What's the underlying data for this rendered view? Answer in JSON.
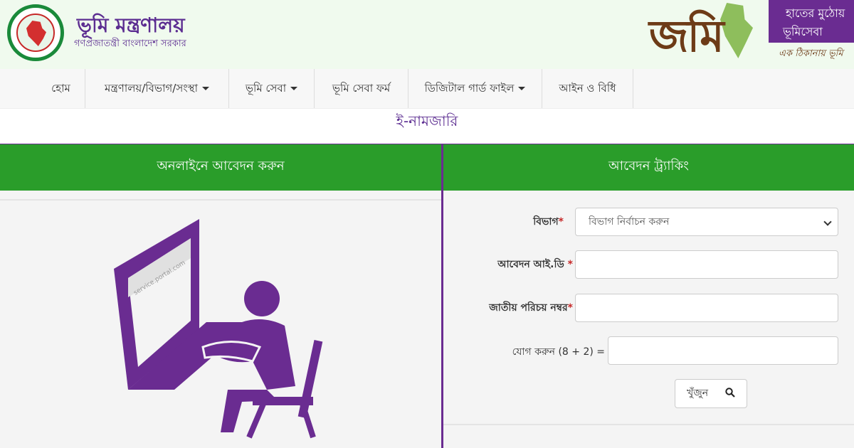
{
  "header": {
    "title": "ভূমি মন্ত্রণালয়",
    "subtitle": "গণপ্রজাতন্ত্রী বাংলাদেশ সরকার",
    "seal": {
      "text_top": "গণপ্রজাতন্ত্রী বাংলাদেশ",
      "text_bottom": "সরকার"
    },
    "logo": {
      "text": "জমি"
    },
    "slogan": {
      "line1": "হাতের মুঠোয়",
      "line2": "ভূমিসেবা",
      "tagline": "এক ঠিকানায় ভূমি"
    }
  },
  "nav": [
    {
      "label": "হোম",
      "dropdown": false
    },
    {
      "label": "মন্ত্রণালয়/বিভাগ/সংস্থা",
      "dropdown": true
    },
    {
      "label": "ভূমি সেবা",
      "dropdown": true
    },
    {
      "label": "ভূমি সেবা ফর্ম",
      "dropdown": false
    },
    {
      "label": "ডিজিটাল গার্ড ফাইল",
      "dropdown": true
    },
    {
      "label": "আইন ও বিধি",
      "dropdown": false
    }
  ],
  "page_title": "ই-নামজারি",
  "left_panel": {
    "heading": "অনলাইনে আবেদন করুন",
    "illustration_url_text": "service.portal.com"
  },
  "right_panel": {
    "heading": "আবেদন ট্র্যাকিং",
    "fields": {
      "division": {
        "label": "বিভাগ",
        "required": "*",
        "selected": "বিভাগ নির্বাচন করুন"
      },
      "application_id": {
        "label": "আবেদন আই.ডি ",
        "required": "*",
        "value": ""
      },
      "nid": {
        "label": "জাতীয় পরিচয় নম্বর",
        "required": "*",
        "value": ""
      },
      "captcha": {
        "label": "যোগ করুন (8 + 2) =",
        "value": ""
      }
    },
    "search_button": "খুঁজুন"
  },
  "colors": {
    "brand_purple": "#6a2c91",
    "header_green": "#2a9d2a",
    "header_bg": "#f0faee",
    "logo_brown": "#6d3b17"
  }
}
